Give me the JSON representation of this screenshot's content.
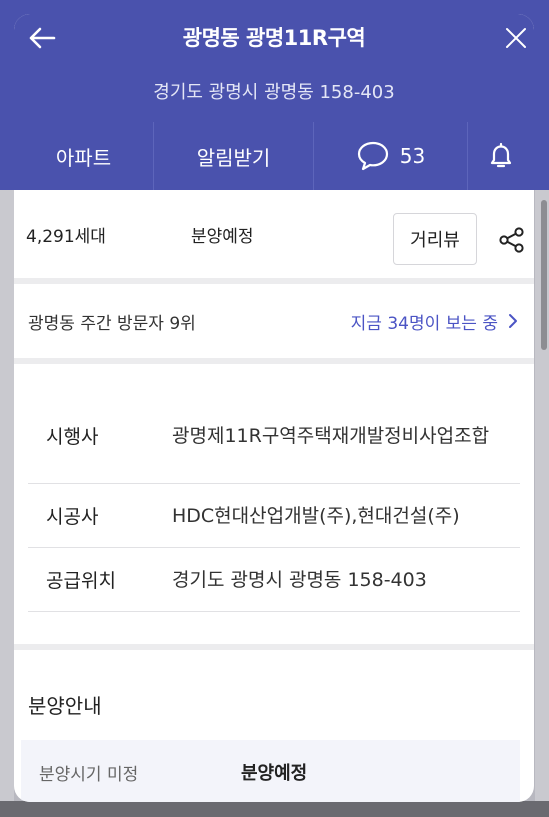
{
  "header": {
    "title": "광명동 광명11R구역",
    "address": "경기도 광명시 광명동 158-403",
    "back_icon": "arrow-left-icon",
    "close_icon": "close-icon",
    "bg_color": "#4a52ad"
  },
  "tabs": {
    "apartment": "아파트",
    "notify": "알림받기",
    "comment_count": "53"
  },
  "summary": {
    "units": "4,291세대",
    "status": "분양예정",
    "street_view": "거리뷰"
  },
  "visitors": {
    "rank": "광명동 주간 방문자 9위",
    "live": "지금 34명이 보는 중"
  },
  "info": {
    "rows": [
      {
        "label": "시행사",
        "value": "광명제11R구역주택재개발정비사업조합"
      },
      {
        "label": "시공사",
        "value": "HDC현대산업개발(주),현대건설(주)"
      },
      {
        "label": "공급위치",
        "value": "경기도 광명시 광명동 158-403"
      }
    ]
  },
  "sale": {
    "title": "분양안내",
    "schedule_label": "분양시기 미정",
    "schedule_value": "분양예정"
  },
  "colors": {
    "accent": "#4b54c4",
    "header": "#4a52ad"
  }
}
